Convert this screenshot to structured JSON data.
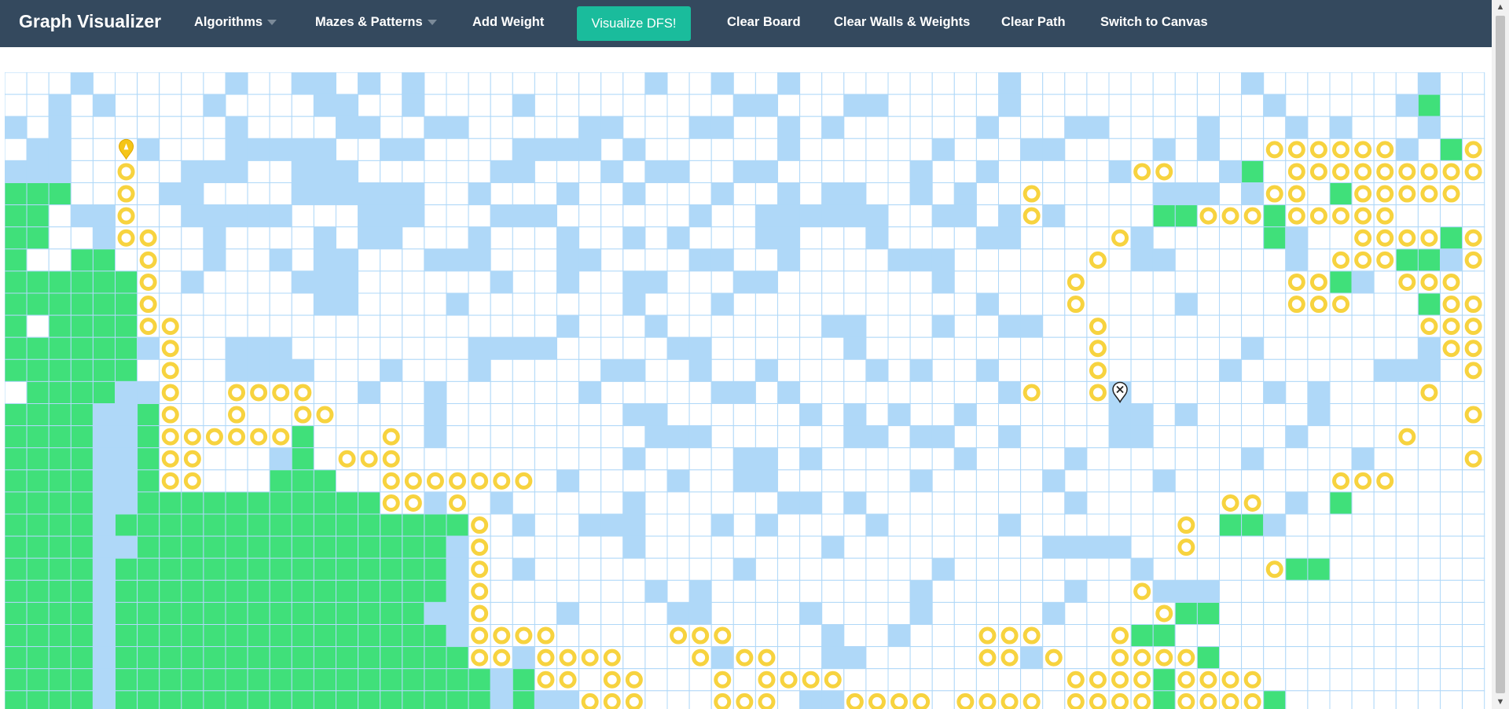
{
  "app": {
    "title": "Graph Visualizer"
  },
  "nav": {
    "algorithms": "Algorithms",
    "mazes": "Mazes & Patterns",
    "add_weight": "Add Weight",
    "visualize": "Visualize DFS!",
    "clear_board": "Clear Board",
    "clear_walls": "Clear Walls & Weights",
    "clear_path": "Clear Path",
    "switch_canvas": "Switch to Canvas"
  },
  "icons": {
    "start": "start-marker-icon",
    "target": "target-marker-icon",
    "dropdown": "chevron-down-icon"
  },
  "colors": {
    "navbar": "#34495e",
    "accent": "#1abc9c",
    "wall": "#afd8f8",
    "visited": "#40e07a",
    "path": "#f7d33f",
    "grid_line": "#afd8f8"
  },
  "legend": {
    "W": "wall",
    "V": "visited",
    "P": "path",
    "S": "start",
    "T": "target",
    ".": "unvisited"
  },
  "grid": [
    "...W......W..WW.W.W..........W..W..W.........W..........W.......W...........W.....W..PPP.WW",
    "..W.W....W....WW..W....W.........WW...WW.....W...........W.....WV..W...PPP.W......",
    "W.W.......W....WW..WW.....WW...WW..W.W......W...WW....W...W.W...W..WV.W..PPP.WWW.",
    ".WW..SW...WWWWW..WW....WWWW.W......W......W...WW....W.W..PPPPPPW.VPPPPPPWV",
    "WWW..P..WWW..WWW......WW...W.WW..WW......W..W.....WPP..WV.PPPPPPPPP.WV",
    "VVV..P.WW....WWWWWW..W...W..W...W..W.WW..W.W..P.....WWW.WPP.VPPPPP",
    "VV.WWP..WWWWW...WWW...WWW......W..WWWWWW..WW.WPW....VVPPPVPPPPP",
    "VV..WPP..W....W.WW...W...W..W.W...WW...W....WW....PW.....VW..PPPPVPPP",
    "V..VV.P..W..W.WW...WWW...WW....WW..W....WWW......P.WW.....W.PPPVVWP..V",
    "VVVVVVP.W....WWW......W..W..WW...WW.......W.....P.........PPVW.PPP",
    "VVVVVVP.......WW....W.......W...W...........W...P....W....PPP...VPPP.WW",
    "V.VVVVPP.................W...W.......WW...W..WW..P..............PPPPPP",
    "VVVVVVWP..WWW........WWWW.....WW......W..........P......W.......WPPPP",
    "VVVVVV.P..WWWW...W...W.....WW..W..W....W.W..W....P.....W......WWW.PPP",
    ".VVVVWWP..PPPP..W..W......W.....WW.W.........WP..PW......W.W....P",
    "VVVVWWVP..P..PP....W........WW......W.W.W..W......WW.W.....W......P",
    "VVVVWWVPPPPPPV...P.W.........WWW......WW.WW..W....WW......W....P",
    "VVVVWWVPP...WV.PPP..........W....WW.W......W....W.......W....W....P",
    "VVVVWWVPP...VVV..PPPPPPP.W....W..WW......W.....W....W.......PPP",
    "VVVVWWVVVVVVVVVVVPPWP.W.....W......WW.W.........W......PP.W.V",
    "VVVVWVVVVVVVVVVVVVVVVP.W..WWW...W.W....W.....W.......P.VVW",
    "VVVVWWVVVVVVVVVVVVVVWP......W........W.........WWWW..P..",
    "VVVVWVVVVVVVVVVVVVVVWP.W.........W........W........W.....PVV",
    "VVVVWVVVVVVVVVVVVVVVWP.......W.W.........W......W..PWWW",
    "VVVVWVVVVVVVVVVVVVVWWP...W....WW....W....W.....W....PVV",
    "VVVVWVVVVVVVVVVVVVVVWPPPP.....PPP....W..W...PPP...PVV",
    "VVVVWVVVVVVVVVVVVVVVVPPWPPPP...PWPP..WW.....PPWP..PPPPV",
    "VVVVWVVVVVVVVVVVVVVVVVWVPP.PP...P.PPPP..........PPPPVPPPP",
    "VVVVWVVVVVVVVVVVVVVVVVWVWWPPP...PPP.WWPPPP.PPPP.PPPPVPPPPV",
    "VVVVWVVVVVVVVVVVVVVVVVVWWVVPPPPPPPPPPPPPPPPPPPPPPPPPPPPPPPVV"
  ],
  "start": {
    "row": 3,
    "col": 5
  },
  "target": {
    "row": 14,
    "col": 50
  }
}
